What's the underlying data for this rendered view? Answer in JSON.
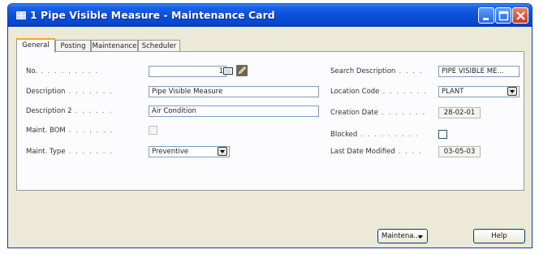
{
  "window": {
    "title": "1 Pipe Visible Measure - Maintenance Card"
  },
  "tabs": [
    {
      "label": "General"
    },
    {
      "label": "Posting"
    },
    {
      "label": "Maintenance"
    },
    {
      "label": "Scheduler"
    }
  ],
  "general": {
    "no_label": "No.",
    "no_value": "1",
    "description_label": "Description",
    "description_value": "Pipe Visible Measure",
    "description2_label": "Description 2",
    "description2_value": "Air Condition",
    "maint_bom_label": "Maint. BOM",
    "maint_bom_checked": false,
    "maint_type_label": "Maint. Type",
    "maint_type_value": "Preventive",
    "search_description_label": "Search Description",
    "search_description_value": "PIPE VISIBLE ME...",
    "location_code_label": "Location Code",
    "location_code_value": "PLANT",
    "creation_date_label": "Creation Date",
    "creation_date_value": "28-02-01",
    "blocked_label": "Blocked",
    "blocked_checked": false,
    "last_date_modified_label": "Last Date Modified",
    "last_date_modified_value": "03-05-03"
  },
  "buttons": {
    "maintenance_label": "Maintena...",
    "help_label": "Help"
  },
  "icons": {
    "app": "form-icon",
    "assist_edit": "pencil-icon",
    "lookup": "lookup-icon"
  }
}
